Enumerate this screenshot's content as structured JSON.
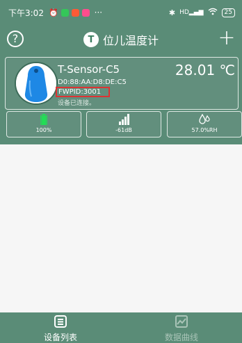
{
  "status_bar": {
    "time": "下午3:02",
    "indicators": [
      "alarm-icon",
      "app-icon-green",
      "app-icon-orange",
      "app-icon-pink",
      "more-dots"
    ],
    "right": {
      "bluetooth": "bluetooth-icon",
      "signal": "HD",
      "wifi": "wifi-icon",
      "battery": "25"
    }
  },
  "app_bar": {
    "title": "位儿温度计",
    "help_icon": "help-circle-icon",
    "add_icon": "plus-icon",
    "logo_letter": "T"
  },
  "device": {
    "name": "T-Sensor-C5",
    "mac": "D0:88:AA:D8:DE:C5",
    "fwpid": "FWPID:3001",
    "connection_status": "设备已连接。",
    "temperature": "28.01 ℃",
    "stats": {
      "battery": "100%",
      "battery_level": 1.0,
      "signal": "-61dB",
      "humidity": "57.0%RH"
    }
  },
  "bottom_nav": {
    "items": [
      {
        "label": "设备列表",
        "icon": "list-icon",
        "active": true
      },
      {
        "label": "数据曲线",
        "icon": "chart-icon",
        "active": false
      }
    ]
  },
  "colors": {
    "primary": "#5a8c77",
    "highlight_border": "#dd3333",
    "battery_green": "#22dd55",
    "device_blue": "#1e88e5",
    "inactive_nav": "#a9c4b7"
  }
}
